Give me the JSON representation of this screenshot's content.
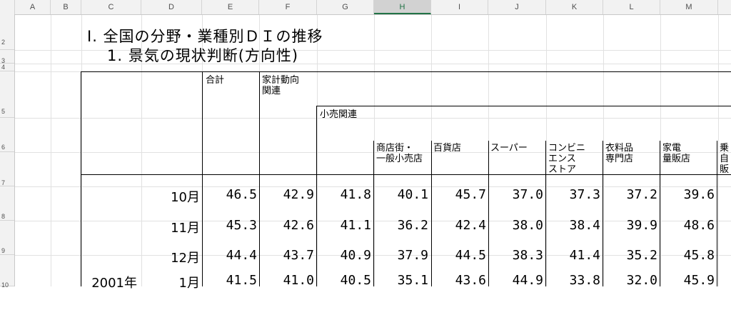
{
  "columns": [
    "A",
    "B",
    "C",
    "D",
    "E",
    "F",
    "G",
    "H",
    "I",
    "J",
    "K",
    "L",
    "M"
  ],
  "selected_column": "H",
  "rows": [
    "2",
    "3",
    "4",
    "5",
    "6",
    "7",
    "8",
    "9",
    "10"
  ],
  "title1": "Ⅰ. 全国の分野・業種別ＤＩの推移",
  "title2": "1. 景気の現状判断(方向性)",
  "headers": {
    "total": "合計",
    "household": "家計動向\n関連",
    "retail": "小売関連",
    "shopping_street": "商店街・\n一般小売店",
    "department_store": "百貨店",
    "supermarket": "スーパー",
    "convenience_store": "コンビニ\nエンス\nストア",
    "clothing": "衣料品\n専門店",
    "electronics": "家電\n量販店",
    "car_partial": "乗\n自\n販"
  },
  "data_rows": [
    {
      "year": "",
      "month": "10月",
      "values": [
        "46.5",
        "42.9",
        "41.8",
        "40.1",
        "45.7",
        "37.0",
        "37.3",
        "37.2",
        "39.6"
      ]
    },
    {
      "year": "",
      "month": "11月",
      "values": [
        "45.3",
        "42.6",
        "41.1",
        "36.2",
        "42.4",
        "38.0",
        "38.4",
        "39.9",
        "48.6"
      ]
    },
    {
      "year": "",
      "month": "12月",
      "values": [
        "44.4",
        "43.7",
        "40.9",
        "37.9",
        "44.5",
        "38.3",
        "41.4",
        "35.2",
        "45.8"
      ]
    },
    {
      "year": "2001年",
      "month": "1月",
      "values": [
        "41.5",
        "41.0",
        "40.5",
        "35.1",
        "43.6",
        "44.9",
        "33.8",
        "32.0",
        "45.9"
      ]
    }
  ]
}
